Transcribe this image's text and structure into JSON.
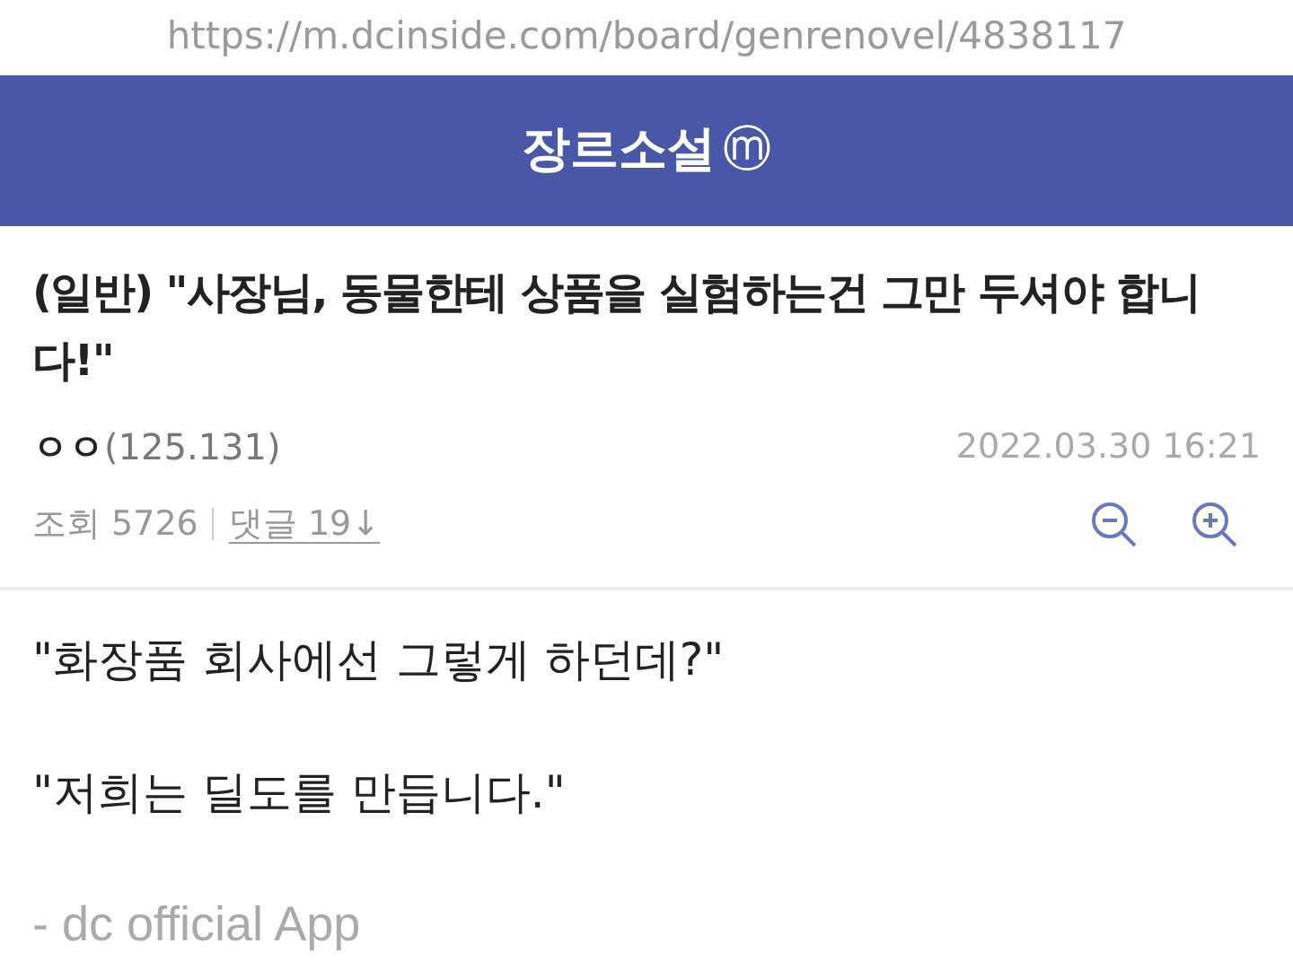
{
  "url": "https://m.dcinside.com/board/genrenovel/4838117",
  "header": {
    "title": "장르소설",
    "badge": "ⓜ"
  },
  "post": {
    "title": "(일반) \"사장님, 동물한테 상품을 실험하는건 그만 두셔야 합니다!\"",
    "author": "ㅇㅇ",
    "ip": "(125.131)",
    "date": "2022.03.30 16:21",
    "views": "조회 5726",
    "comments": "댓글 19↓"
  },
  "body": [
    "\"화장품 회사에선 그렇게 하던데?\"",
    "\"저희는 딜도를 만듭니다.\""
  ],
  "signature": "- dc official App"
}
